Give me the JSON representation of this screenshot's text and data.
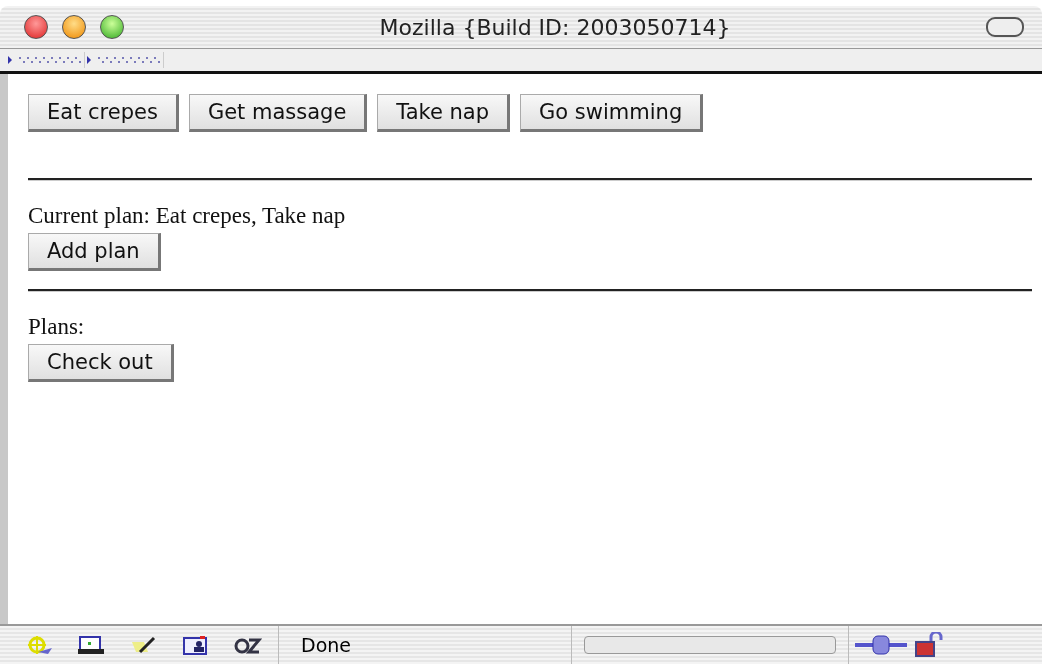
{
  "window": {
    "title": "Mozilla {Build ID: 2003050714}"
  },
  "activities": [
    {
      "label": "Eat crepes"
    },
    {
      "label": "Get massage"
    },
    {
      "label": "Take nap"
    },
    {
      "label": "Go swimming"
    }
  ],
  "current_plan": {
    "text": "Current plan: Eat crepes, Take nap",
    "button": "Add plan"
  },
  "plans": {
    "label": "Plans:",
    "button": "Check out"
  },
  "status_bar": {
    "text": "Done",
    "progress": {
      "level": 0
    }
  }
}
